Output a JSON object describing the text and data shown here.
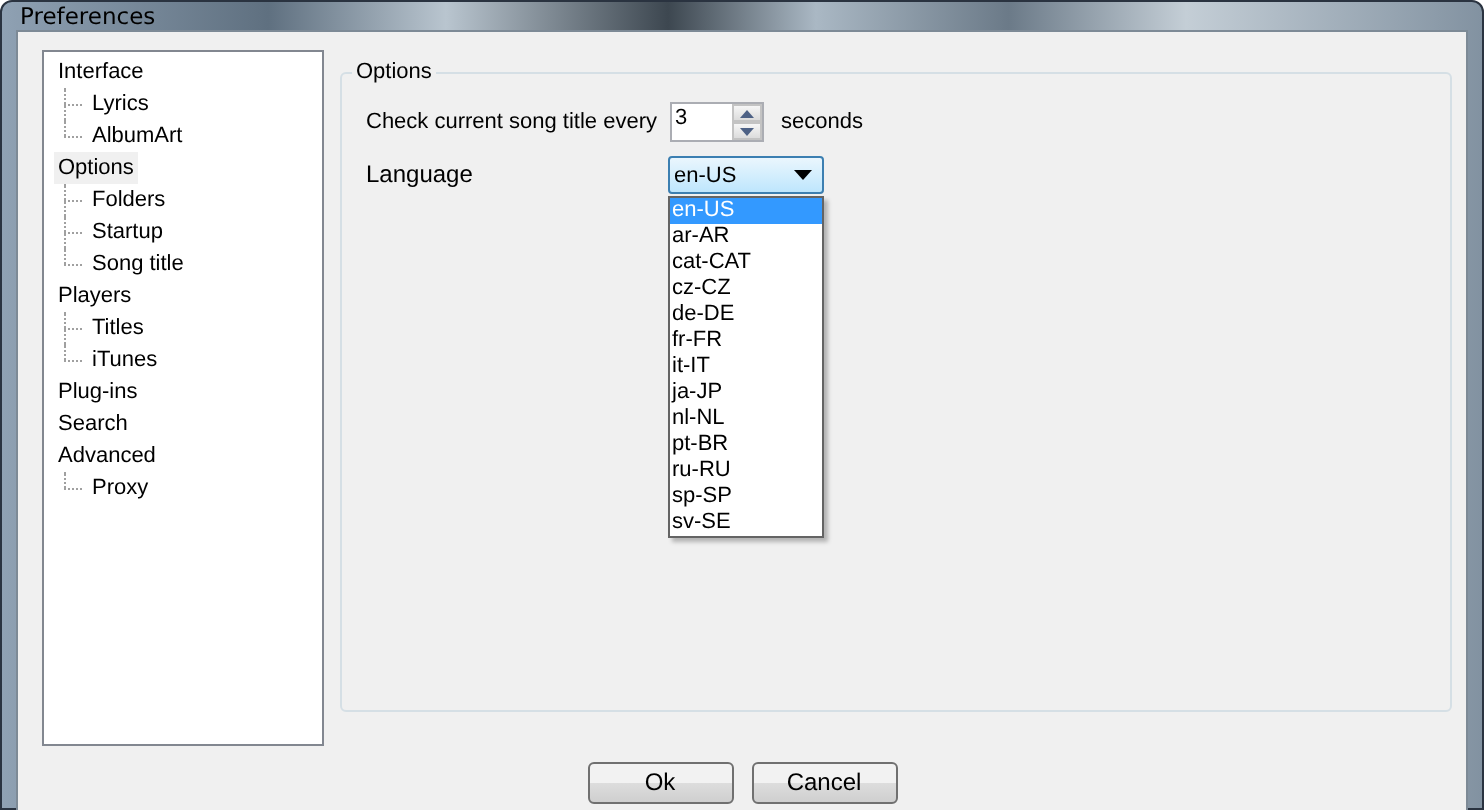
{
  "window": {
    "title": "Preferences"
  },
  "tree": [
    {
      "label": "Interface",
      "selected": false,
      "children": [
        {
          "label": "Lyrics",
          "selected": false
        },
        {
          "label": "AlbumArt",
          "selected": false
        }
      ]
    },
    {
      "label": "Options",
      "selected": true,
      "children": [
        {
          "label": "Folders",
          "selected": false
        },
        {
          "label": "Startup",
          "selected": false
        },
        {
          "label": "Song title",
          "selected": false
        }
      ]
    },
    {
      "label": "Players",
      "selected": false,
      "children": [
        {
          "label": "Titles",
          "selected": false
        },
        {
          "label": "iTunes",
          "selected": false
        }
      ]
    },
    {
      "label": "Plug-ins",
      "selected": false
    },
    {
      "label": "Search",
      "selected": false
    },
    {
      "label": "Advanced",
      "selected": false,
      "children": [
        {
          "label": "Proxy",
          "selected": false
        }
      ]
    }
  ],
  "options_group": {
    "title": "Options",
    "check_interval": {
      "label": "Check current song title every",
      "value": "3",
      "unit": "seconds"
    },
    "language": {
      "label": "Language",
      "value": "en-US",
      "expanded": true,
      "options": [
        {
          "label": "en-US",
          "selected": true
        },
        {
          "label": "ar-AR",
          "selected": false
        },
        {
          "label": "cat-CAT",
          "selected": false
        },
        {
          "label": "cz-CZ",
          "selected": false
        },
        {
          "label": "de-DE",
          "selected": false
        },
        {
          "label": "fr-FR",
          "selected": false
        },
        {
          "label": "it-IT",
          "selected": false
        },
        {
          "label": "ja-JP",
          "selected": false
        },
        {
          "label": "nl-NL",
          "selected": false
        },
        {
          "label": "pt-BR",
          "selected": false
        },
        {
          "label": "ru-RU",
          "selected": false
        },
        {
          "label": "sp-SP",
          "selected": false
        },
        {
          "label": "sv-SE",
          "selected": false
        }
      ]
    }
  },
  "buttons": [
    {
      "label": "Ok"
    },
    {
      "label": "Cancel"
    }
  ]
}
